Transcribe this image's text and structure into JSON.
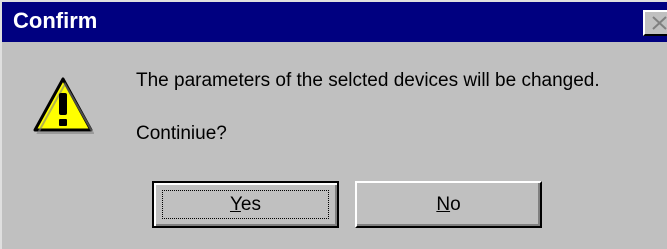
{
  "dialog": {
    "title": "Confirm",
    "close_glyph": "✕",
    "message": "The parameters of the selcted devices will be changed.",
    "question": "Continiue?",
    "icon": "warning-exclamation-icon",
    "colors": {
      "titlebar": "#000080",
      "face": "#c0c0c0",
      "warning_fill": "#ffff00"
    }
  },
  "buttons": {
    "yes": {
      "mnemonic": "Y",
      "rest": "es"
    },
    "no": {
      "mnemonic": "N",
      "rest": "o"
    }
  }
}
